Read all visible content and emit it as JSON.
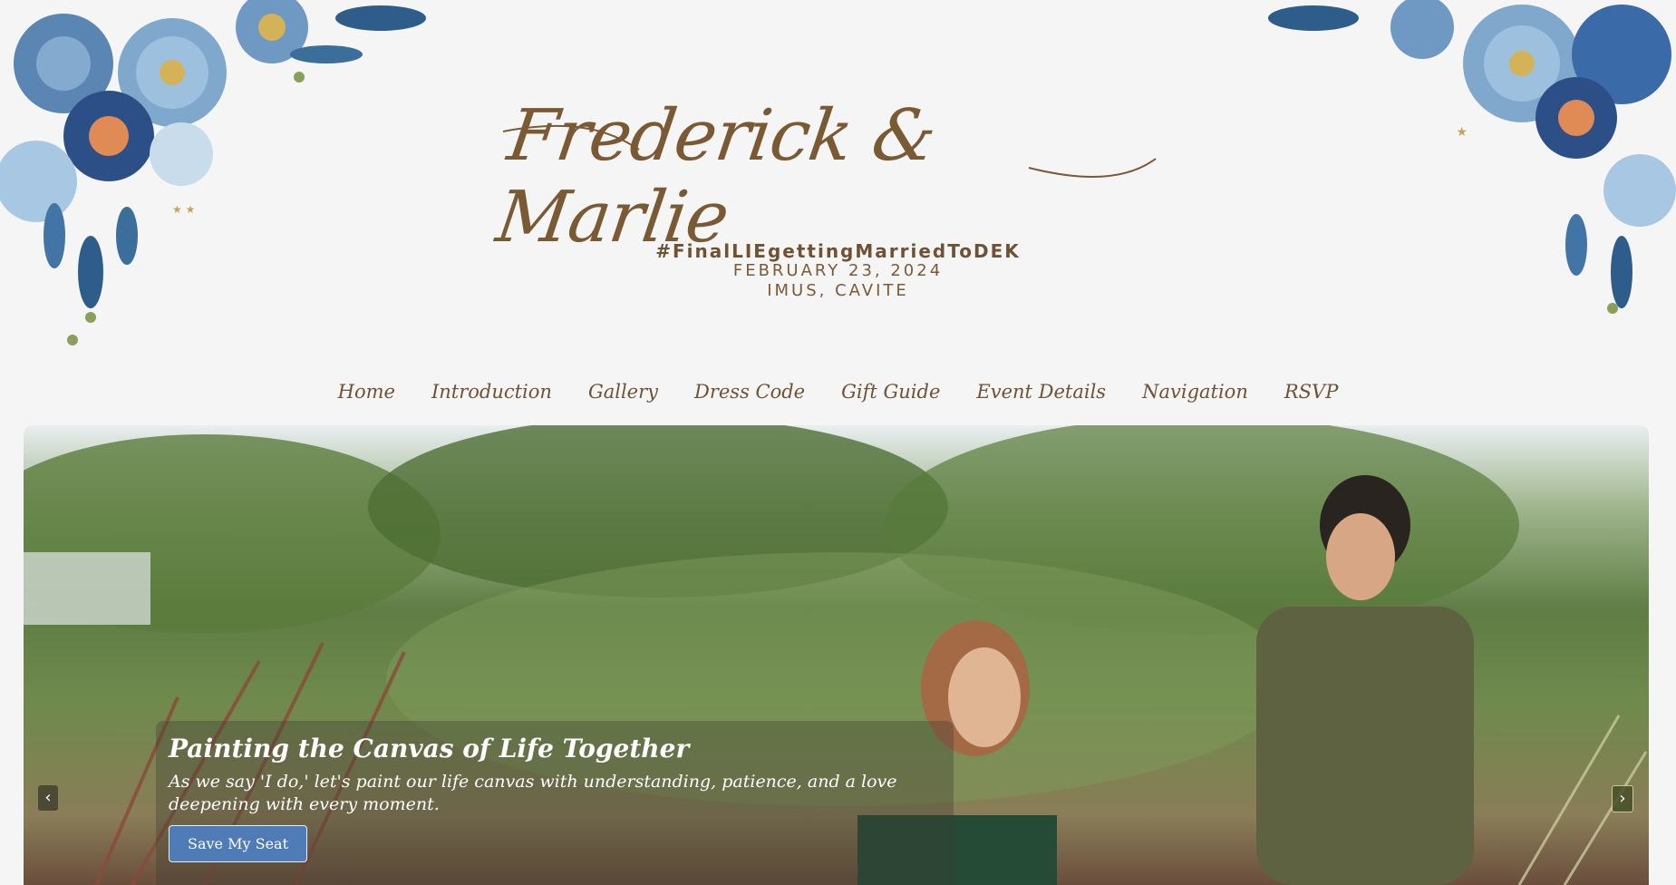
{
  "header": {
    "title": "Frederick & Marlie",
    "hashtag": "#FinalLIEgettingMarriedToDEK",
    "date": "FEBRUARY 23, 2024",
    "venue": "IMUS, CAVITE"
  },
  "nav": {
    "items": [
      {
        "label": "Home"
      },
      {
        "label": "Introduction"
      },
      {
        "label": "Gallery"
      },
      {
        "label": "Dress Code"
      },
      {
        "label": "Gift Guide"
      },
      {
        "label": "Event Details"
      },
      {
        "label": "Navigation"
      },
      {
        "label": "RSVP"
      }
    ]
  },
  "hero": {
    "heading": "Painting the Canvas of Life Together",
    "body": "As we say 'I do,' let's paint our life canvas with understanding, patience, and a love deepening with every moment.",
    "cta_label": "Save My Seat",
    "prev_icon": "‹",
    "next_icon": "›"
  },
  "colors": {
    "accent_brown": "#7a5a35",
    "button_blue": "#4f7bb6",
    "background": "#f5f5f5"
  }
}
